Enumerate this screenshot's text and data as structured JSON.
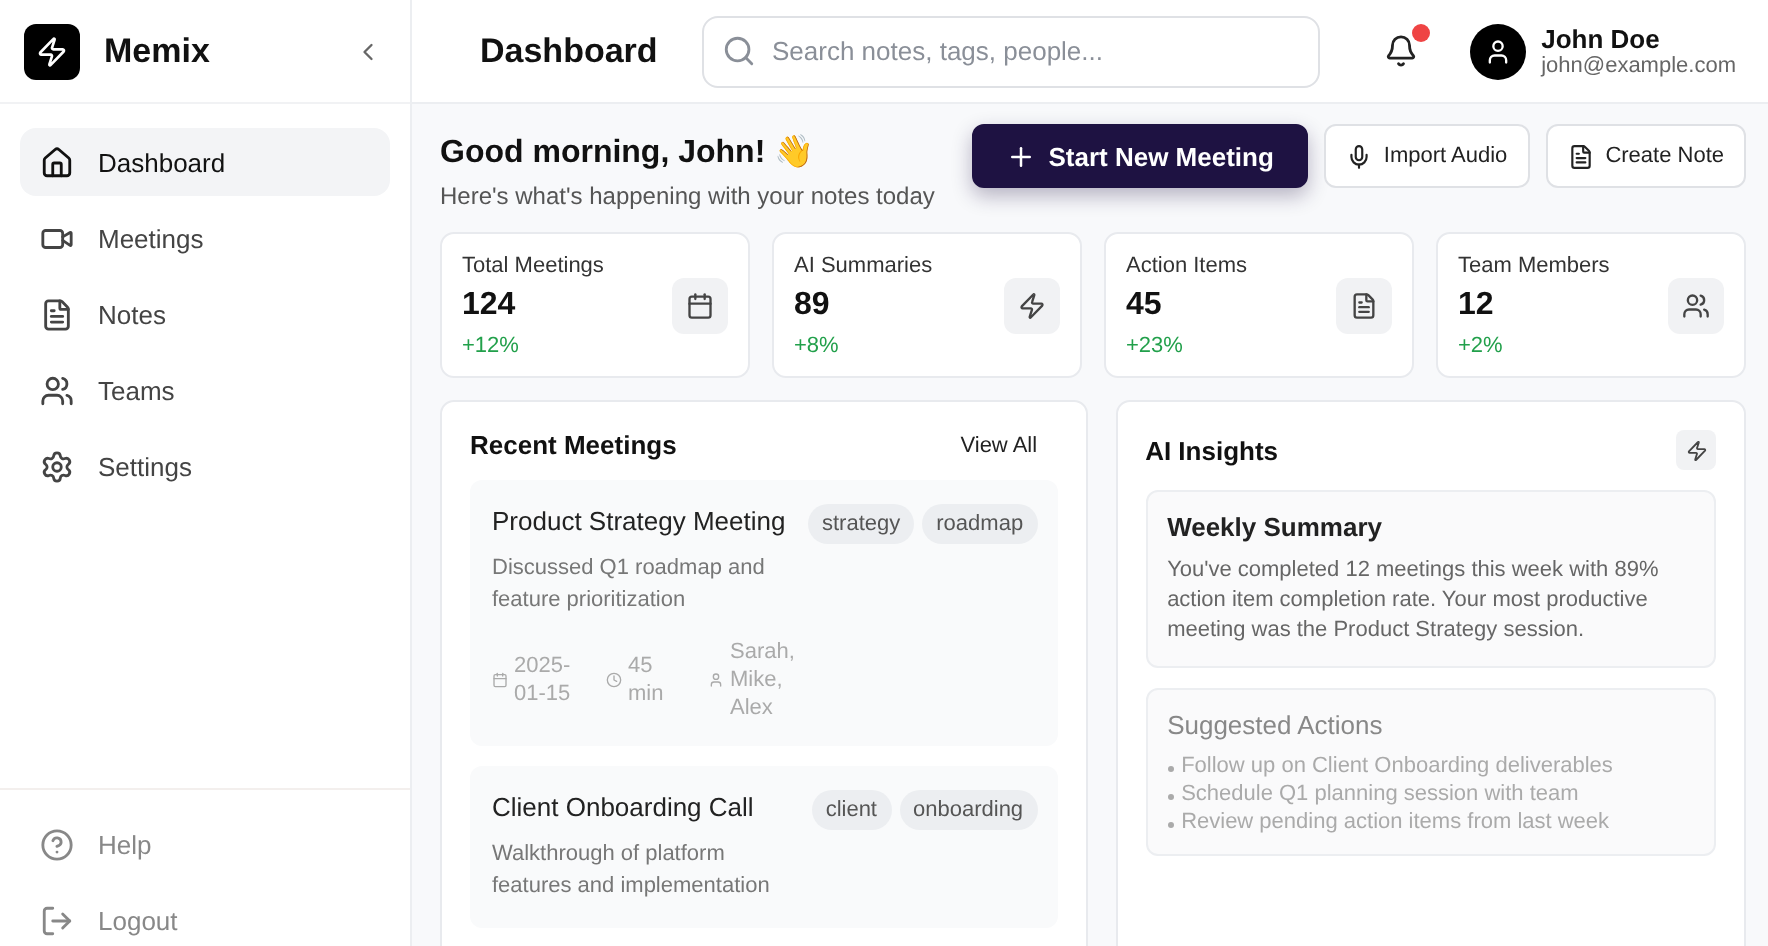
{
  "app": {
    "name": "Memix"
  },
  "sidebar": {
    "items": [
      {
        "label": "Dashboard",
        "selected": true
      },
      {
        "label": "Meetings",
        "selected": false
      },
      {
        "label": "Notes",
        "selected": false
      },
      {
        "label": "Teams",
        "selected": false
      },
      {
        "label": "Settings",
        "selected": false
      }
    ],
    "footer": [
      {
        "label": "Help"
      },
      {
        "label": "Logout"
      }
    ]
  },
  "header": {
    "title": "Dashboard",
    "search": {
      "placeholder": "Search notes, tags, people..."
    },
    "notifications": {
      "unread": true
    },
    "user": {
      "name": "John Doe",
      "email": "john@example.com"
    }
  },
  "greeting": {
    "title": "Good morning, John! 👋",
    "subtitle": "Here's what's happening with your notes today"
  },
  "actions": [
    {
      "label": "Start New Meeting",
      "kind": "primary"
    },
    {
      "label": "Import Audio",
      "kind": "secondary"
    },
    {
      "label": "Create Note",
      "kind": "secondary"
    }
  ],
  "stats": [
    {
      "label": "Total Meetings",
      "value": "124",
      "change": "+12%"
    },
    {
      "label": "AI Summaries",
      "value": "89",
      "change": "+8%"
    },
    {
      "label": "Action Items",
      "value": "45",
      "change": "+23%"
    },
    {
      "label": "Team Members",
      "value": "12",
      "change": "+2%"
    }
  ],
  "recent_meetings": {
    "title": "Recent Meetings",
    "link": "View All",
    "items": [
      {
        "title": "Product Strategy Meeting",
        "summary": "Discussed Q1 roadmap and feature prioritization",
        "tags": [
          "strategy",
          "roadmap"
        ],
        "date": "2025-01-15",
        "duration": "45 min",
        "attendees": "Sarah, Mike, Alex"
      },
      {
        "title": "Client Onboarding Call",
        "summary": "Walkthrough of platform features and implementation",
        "tags": [
          "client",
          "onboarding"
        ]
      }
    ]
  },
  "ai_insights": {
    "title": "AI Insights",
    "weekly_summary": {
      "title": "Weekly Summary",
      "text": "You've completed 12 meetings this week with 89% action item completion rate. Your most productive meeting was the Product Strategy session."
    },
    "suggested_actions": {
      "title": "Suggested Actions",
      "items": [
        "Follow up on Client Onboarding deliverables",
        "Schedule Q1 planning session with team",
        "Review pending action items from last week"
      ]
    }
  }
}
